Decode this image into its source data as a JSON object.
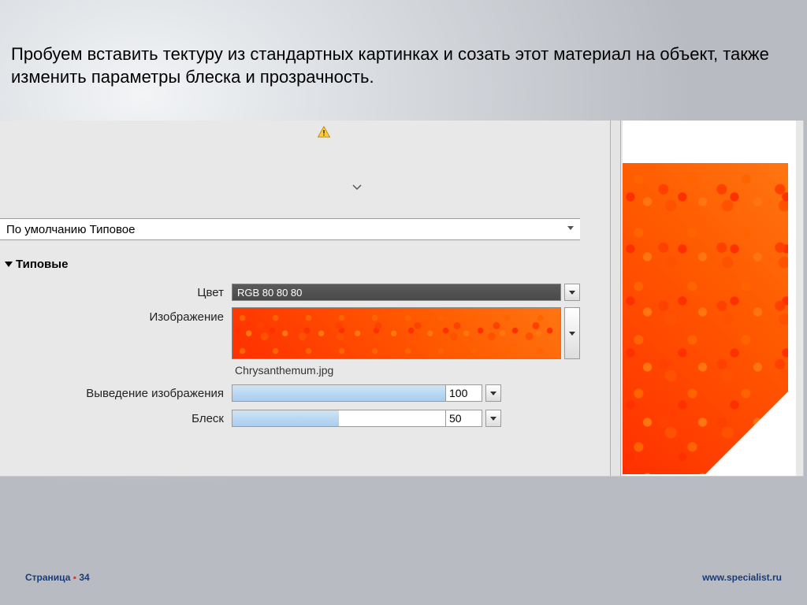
{
  "slide": {
    "title": "Пробуем вставить тектуру из стандартных картинках и созать этот материал на объект, также изменить параметры блеска и прозрачность.",
    "page_label": "Страница",
    "page_number": "34",
    "url": "www.specialist.ru"
  },
  "panel": {
    "style_dropdown": "По умолчанию Типовое",
    "section": "Типовые",
    "labels": {
      "color": "Цвет",
      "image": "Изображение",
      "image_fade": "Выведение изображения",
      "gloss": "Блеск"
    },
    "color_value": "RGB 80 80 80",
    "image_file": "Chrysanthemum.jpg",
    "image_fade_value": "100",
    "gloss_value": "50"
  }
}
